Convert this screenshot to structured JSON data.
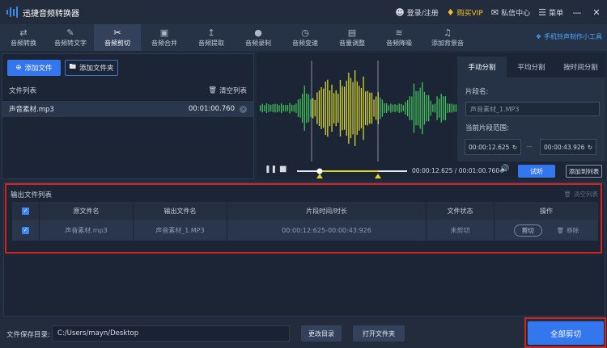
{
  "app": {
    "title": "迅捷音频转换器",
    "login": "登录/注册",
    "vip": "购买VIP",
    "message_center": "私信中心",
    "menu": "菜单"
  },
  "toolbar": {
    "items": [
      {
        "label": "音频转换",
        "icon": "convert-icon"
      },
      {
        "label": "音频转文字",
        "icon": "text-icon"
      },
      {
        "label": "音频剪切",
        "icon": "scissors-icon"
      },
      {
        "label": "音频合并",
        "icon": "merge-icon"
      },
      {
        "label": "音频提取",
        "icon": "extract-icon"
      },
      {
        "label": "音频录制",
        "icon": "mic-icon"
      },
      {
        "label": "音频变速",
        "icon": "speed-icon"
      },
      {
        "label": "音量调整",
        "icon": "volume-icon"
      },
      {
        "label": "音频降噪",
        "icon": "denoise-icon"
      },
      {
        "label": "添加背景音",
        "icon": "music-icon"
      }
    ],
    "active_index": 2,
    "ringtone_tool": "手机铃声制作小工具"
  },
  "file_panel": {
    "add_file": "添加文件",
    "add_folder": "添加文件夹",
    "list_title": "文件列表",
    "clear_list": "清空列表",
    "files": [
      {
        "name": "声音素材.mp3",
        "duration": "00:01:00.760"
      }
    ]
  },
  "split": {
    "tabs": [
      "手动分割",
      "平均分割",
      "按时间分割"
    ],
    "active_tab": 0,
    "segment_name_label": "片段名:",
    "segment_name_placeholder": "声音素材_1.MP3",
    "range_label": "当前片段范围:",
    "range_start": "00:00:12.625",
    "range_end": "00:00:43.926",
    "range_separator": "—"
  },
  "player": {
    "current_time": "00:00:12.625",
    "total_time": "00:01:00.760",
    "time_separator": "/",
    "listen": "试听",
    "add_to_list": "添加到列表"
  },
  "output": {
    "title": "输出文件列表",
    "clear": "清空列表",
    "headers": [
      "原文件名",
      "输出文件名",
      "片段时间/时长",
      "文件状态",
      "操作"
    ],
    "rows": [
      {
        "source": "声音素材.mp3",
        "output": "声音素材_1.MP3",
        "range": "00:00:12:625-00:00:43:926",
        "status": "未剪切",
        "cut": "剪切",
        "remove": "移除"
      }
    ]
  },
  "bottom": {
    "save_label": "文件保存目录:",
    "save_path": "C:/Users/mayn/Desktop",
    "change_dir": "更改目录",
    "open_folder": "打开文件夹",
    "cut_all": "全部剪切"
  },
  "colors": {
    "accent": "#3376ee",
    "vip": "#f5c125",
    "highlight": "#d4231f",
    "wave_green": "#3fc25a",
    "wave_yellow": "#d7d62d"
  }
}
